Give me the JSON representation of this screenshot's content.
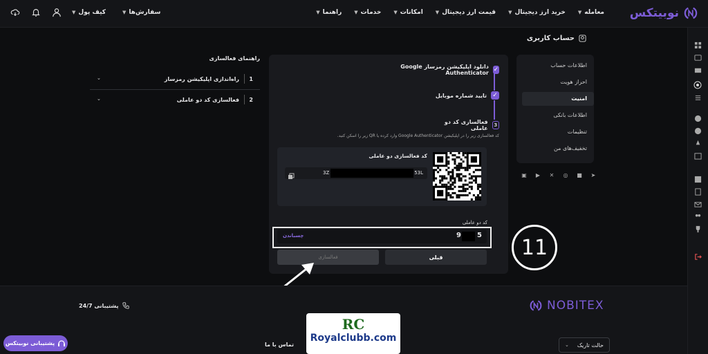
{
  "brand": {
    "name": "نوبیتکس",
    "footer_name": "NOBITEX",
    "accent": "#7c5cd6"
  },
  "nav": {
    "items": [
      "معامله",
      "خرید ارز دیجیتال",
      "قیمت ارز دیجیتال",
      "امکانات",
      "خدمات",
      "راهنما"
    ],
    "orders": "سفارش‌ها",
    "wallet": "کیف پول"
  },
  "page": {
    "title": "حساب کاربری"
  },
  "sidebar": {
    "items": [
      "اطلاعات حساب",
      "احراز هویت",
      "امنیت",
      "اطلاعات بانکی",
      "تنظیمات",
      "تخفیف‌های من"
    ],
    "active_index": 2
  },
  "steps": {
    "s1": "دانلود اپلیکیشن رمزساز Google Authenticator",
    "s2": "تایید شماره موبایل",
    "s3": "فعالسازی کد دو عاملی",
    "s3_num": "3",
    "desc": "کد فعالسازی زیر را در اپلیکیشن Google Authenticator وارد کرده یا QR زیر را اسکن کنید."
  },
  "qr": {
    "title": "کد فعالسازی دو عاملی",
    "key_start": "3Z",
    "key_end": "53L"
  },
  "code": {
    "label": "کد دو عاملی",
    "paste": "چسباندن",
    "digit_first": "5",
    "digit_last": "9"
  },
  "buttons": {
    "activate": "فعالسازی",
    "prev": "قبلی"
  },
  "guide": {
    "title": "راهنمای فعالسازی",
    "items": [
      {
        "n": "1",
        "label": "راه‌اندازی اپلیکیشن رمزساز"
      },
      {
        "n": "2",
        "label": "فعالسازی کد دو عاملی"
      }
    ]
  },
  "footer": {
    "support": "پشتیبانی 24/7",
    "contact": "تماس با ما",
    "chat": "پشتیبانی نوبیتکس",
    "dark": "حالت تاریک"
  },
  "watermark": {
    "rc": "RC",
    "domain": "Royalclubb.com"
  },
  "annotation": {
    "step_number": "11"
  }
}
